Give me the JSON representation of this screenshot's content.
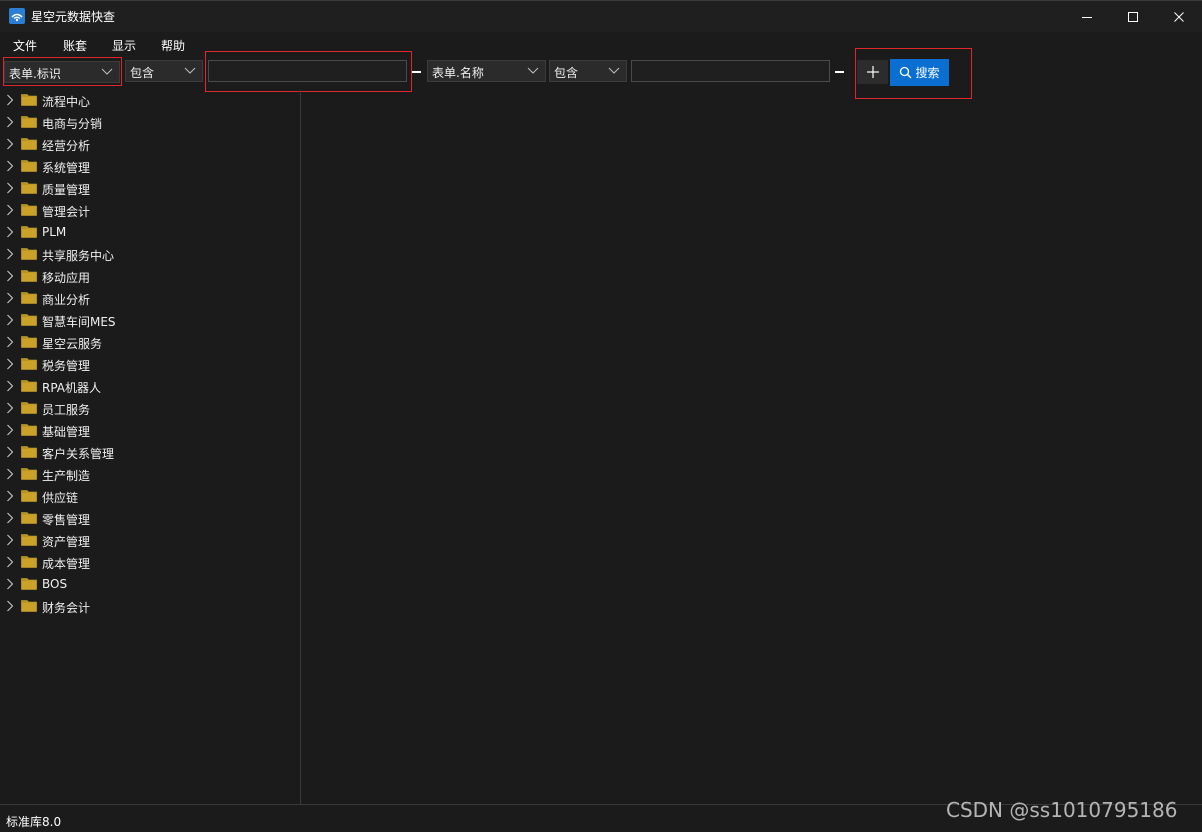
{
  "window": {
    "title": "星空元数据快查",
    "icon": "app-logo-icon"
  },
  "menu": {
    "items": [
      "文件",
      "账套",
      "显示",
      "帮助"
    ]
  },
  "filters": {
    "field1": "表单.标识",
    "op1": "包含",
    "value1": "",
    "field2": "表单.名称",
    "op2": "包含",
    "value2": "",
    "search_label": "搜索"
  },
  "tree": {
    "items": [
      "流程中心",
      "电商与分销",
      "经营分析",
      "系统管理",
      "质量管理",
      "管理会计",
      "PLM",
      "共享服务中心",
      "移动应用",
      "商业分析",
      "智慧车间MES",
      "星空云服务",
      "税务管理",
      "RPA机器人",
      "员工服务",
      "基础管理",
      "客户关系管理",
      "生产制造",
      "供应链",
      "零售管理",
      "资产管理",
      "成本管理",
      "BOS",
      "财务会计"
    ]
  },
  "status": {
    "text": "标准库8.0"
  },
  "watermark": "CSDN @ss1010795186",
  "colors": {
    "accent": "#0a6fd1",
    "highlight": "#e0262d",
    "folder": "#c9a227"
  }
}
